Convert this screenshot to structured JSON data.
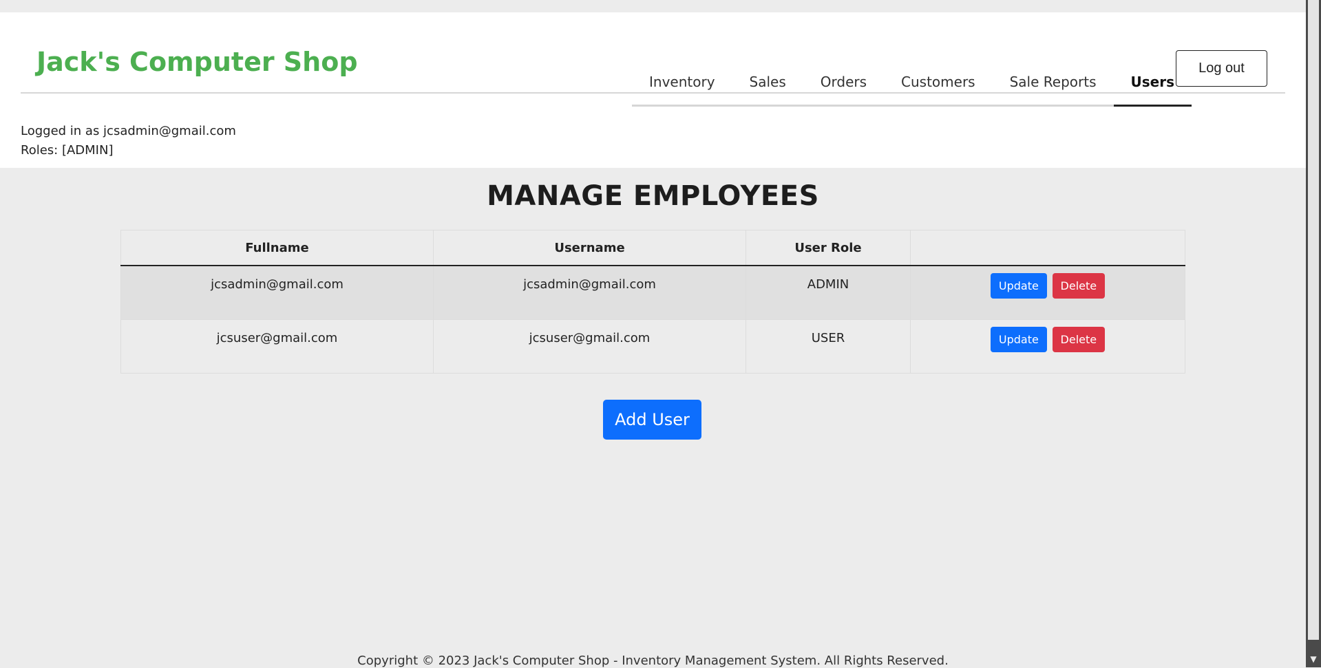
{
  "header": {
    "brand": "Jack's Computer Shop",
    "nav": [
      {
        "label": "Inventory",
        "active": false
      },
      {
        "label": "Sales",
        "active": false
      },
      {
        "label": "Orders",
        "active": false
      },
      {
        "label": "Customers",
        "active": false
      },
      {
        "label": "Sale Reports",
        "active": false
      },
      {
        "label": "Users",
        "active": true
      }
    ],
    "logout_label": "Log out"
  },
  "user_info": {
    "logged_in_text": "Logged in as jcsadmin@gmail.com",
    "roles_text": "Roles: [ADMIN]"
  },
  "main": {
    "title": "MANAGE EMPLOYEES",
    "table": {
      "columns": [
        "Fullname",
        "Username",
        "User Role",
        ""
      ],
      "rows": [
        {
          "fullname": "jcsadmin@gmail.com",
          "username": "jcsadmin@gmail.com",
          "role": "ADMIN"
        },
        {
          "fullname": "jcsuser@gmail.com",
          "username": "jcsuser@gmail.com",
          "role": "USER"
        }
      ],
      "update_label": "Update",
      "delete_label": "Delete"
    },
    "add_user_label": "Add User"
  },
  "footer": {
    "text": "Copyright © 2023 Jack's Computer Shop - Inventory Management System. All Rights Reserved."
  },
  "colors": {
    "brand": "#4caf50",
    "primary": "#0d6efd",
    "danger": "#dc3545",
    "page_bg": "#ececec"
  }
}
